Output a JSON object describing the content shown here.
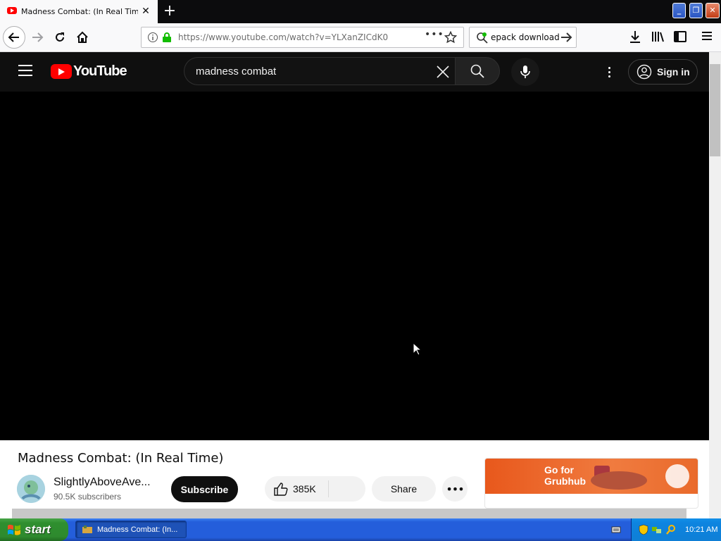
{
  "browser": {
    "tab_title": "Madness Combat: (In Real Time) -",
    "tab_close": "✕",
    "new_tab": "+",
    "url": "https://www.youtube.com/watch?v=YLXanZICdK0",
    "url_more": "•••",
    "search_value": "epack download",
    "window_controls": {
      "minimize": "_",
      "maximize": "❐",
      "close": "✕"
    }
  },
  "youtube": {
    "wordmark": "YouTube",
    "search_query": "madness combat",
    "sign_in_label": "Sign in",
    "video": {
      "title": "Madness Combat: (In Real Time)",
      "channel_name": "SlightlyAboveAve...",
      "subscribers": "90.5K subscribers",
      "subscribe_label": "Subscribe",
      "like_count": "385K",
      "share_label": "Share",
      "more_label": "•••"
    },
    "ad": {
      "headline_line1": "Go for",
      "headline_line2": "Grubhub"
    }
  },
  "taskbar": {
    "start_label": "start",
    "task_label": "Madness Combat: (In...",
    "clock": "10:21 AM"
  },
  "colors": {
    "youtube_red": "#ff0000",
    "masthead_bg": "#0f0f0f",
    "ad_orange": "#f07b3f",
    "xp_blue": "#245edb",
    "xp_green": "#2f8f2f"
  }
}
